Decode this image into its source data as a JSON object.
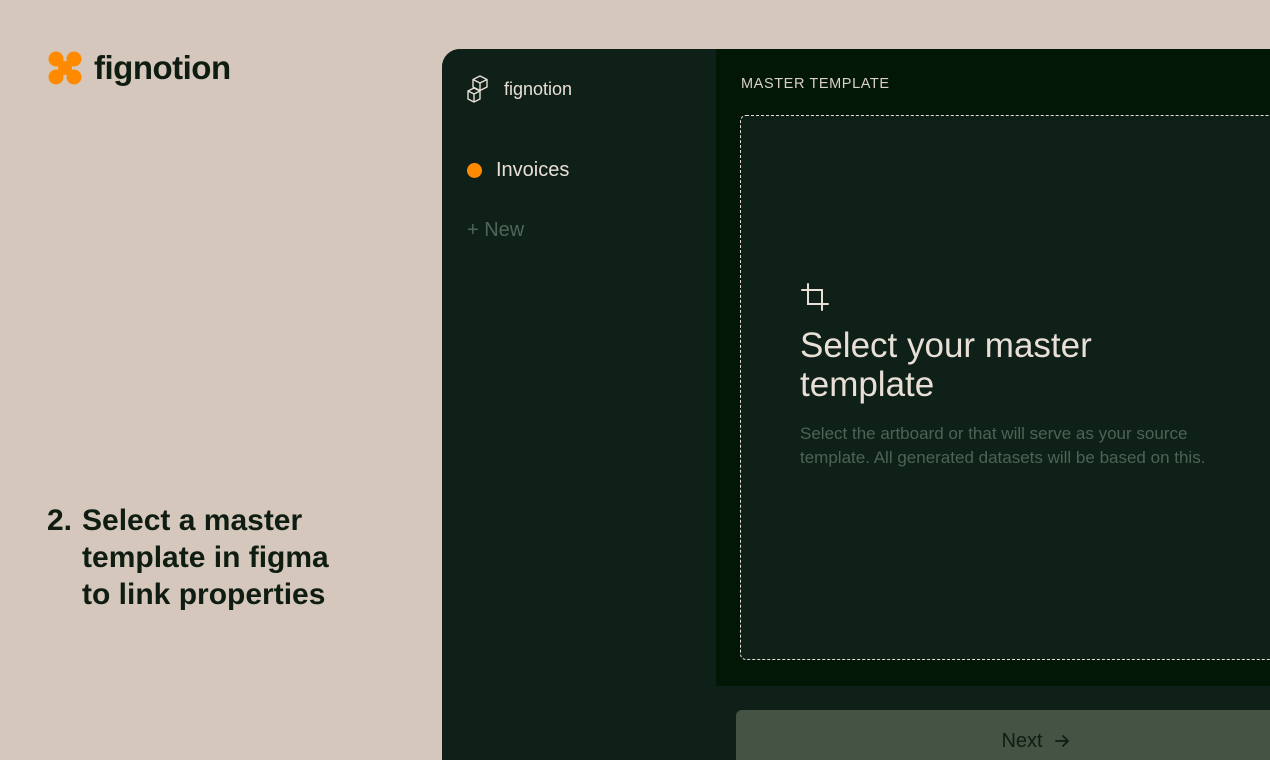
{
  "brand": {
    "name": "fignotion",
    "accent_color": "#ff8a00"
  },
  "step": {
    "number": "2.",
    "text": "Select a master template in figma to link properties"
  },
  "sidebar": {
    "app_name": "fignotion",
    "items": [
      {
        "label": "Invoices",
        "icon": "orange-dot"
      }
    ],
    "new_label": "+ New"
  },
  "main": {
    "section_label": "MASTER TEMPLATE",
    "dropzone": {
      "icon": "crop-icon",
      "title": "Select your master template",
      "description": "Select the artboard or that will serve as your source template. All generated datasets will be based on this."
    },
    "next_button": {
      "label": "Next",
      "icon": "arrow-right-icon"
    }
  }
}
